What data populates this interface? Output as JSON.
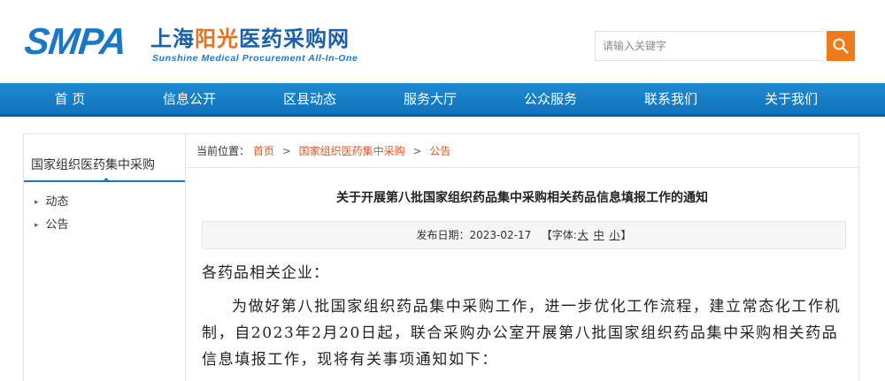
{
  "logo": {
    "smpa": "SMPA",
    "cn_part1": "上海",
    "cn_part2": "阳光",
    "cn_part3": "医药采购网",
    "en": "Sunshine Medical Procurement All-In-One"
  },
  "search": {
    "placeholder": "请输入关键字",
    "button_icon": "search-icon"
  },
  "nav": {
    "items": [
      "首 页",
      "信息公开",
      "区县动态",
      "服务大厅",
      "公众服务",
      "联系我们",
      "关于我们"
    ]
  },
  "sidebar": {
    "title": "国家组织医药集中采购",
    "items": [
      "动态",
      "公告"
    ]
  },
  "breadcrumb": {
    "label": "当前位置：",
    "items": [
      "首页",
      "国家组织医药集中采购",
      "公告"
    ],
    "separator": ">"
  },
  "article": {
    "title": "关于开展第八批国家组织药品集中采购相关药品信息填报工作的通知",
    "date_label": "发布日期：",
    "date": "2023-02-17",
    "font_label_open": "【字体:",
    "font_large": "大",
    "font_medium": "中",
    "font_small": "小",
    "font_label_close": "】",
    "greeting": "各药品相关企业：",
    "paragraph": "为做好第八批国家组织药品集中采购工作，进一步优化工作流程，建立常态化工作机制，自2023年2月20日起，联合采购办公室开展第八批国家组织药品集中采购相关药品信息填报工作，现将有关事项通知如下："
  },
  "colors": {
    "brand_blue": "#1a78c8",
    "brand_orange": "#f07b1d",
    "link_orange": "#e8541a",
    "nav_blue": "#1480c9"
  }
}
